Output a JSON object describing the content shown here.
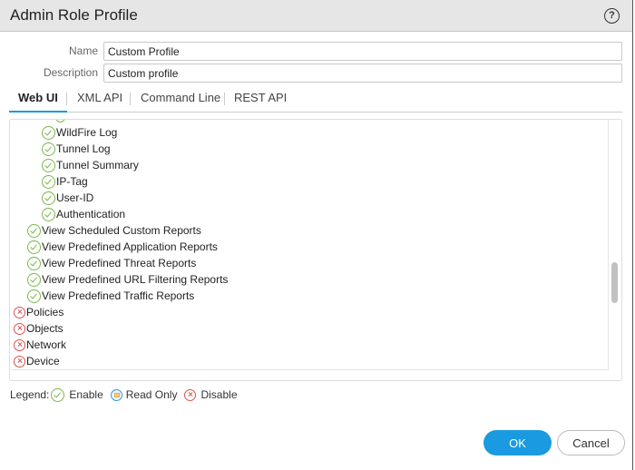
{
  "dialog": {
    "title": "Admin Role Profile",
    "help_icon": "question-circle-icon",
    "help_glyph": "?"
  },
  "form": {
    "name_label": "Name",
    "name_value": "Custom Profile",
    "description_label": "Description",
    "description_value": "Custom profile"
  },
  "tabs": [
    {
      "label": "Web UI",
      "active": true
    },
    {
      "label": "XML API",
      "active": false
    },
    {
      "label": "Command Line",
      "active": false
    },
    {
      "label": "REST API",
      "active": false
    }
  ],
  "tree": {
    "items": [
      {
        "label": "WildFire Log",
        "state": "enable",
        "level": 2
      },
      {
        "label": "Tunnel Log",
        "state": "enable",
        "level": 2
      },
      {
        "label": "Tunnel Summary",
        "state": "enable",
        "level": 2
      },
      {
        "label": "IP-Tag",
        "state": "enable",
        "level": 2
      },
      {
        "label": "User-ID",
        "state": "enable",
        "level": 2
      },
      {
        "label": "Authentication",
        "state": "enable",
        "level": 2
      },
      {
        "label": "View Scheduled Custom Reports",
        "state": "enable",
        "level": 1
      },
      {
        "label": "View Predefined Application Reports",
        "state": "enable",
        "level": 1
      },
      {
        "label": "View Predefined Threat Reports",
        "state": "enable",
        "level": 1
      },
      {
        "label": "View Predefined URL Filtering Reports",
        "state": "enable",
        "level": 1
      },
      {
        "label": "View Predefined Traffic Reports",
        "state": "enable",
        "level": 1
      },
      {
        "label": "Policies",
        "state": "disable",
        "level": 0
      },
      {
        "label": "Objects",
        "state": "disable",
        "level": 0
      },
      {
        "label": "Network",
        "state": "disable",
        "level": 0
      },
      {
        "label": "Device",
        "state": "disable",
        "level": 0
      }
    ]
  },
  "legend": {
    "label": "Legend:",
    "enable": "Enable",
    "read_only": "Read Only",
    "disable": "Disable"
  },
  "buttons": {
    "ok": "OK",
    "cancel": "Cancel"
  },
  "colors": {
    "accent": "#1a9ae0",
    "enable": "#7ab648",
    "disable": "#d9534f",
    "read_only": "#3a9ad9"
  }
}
